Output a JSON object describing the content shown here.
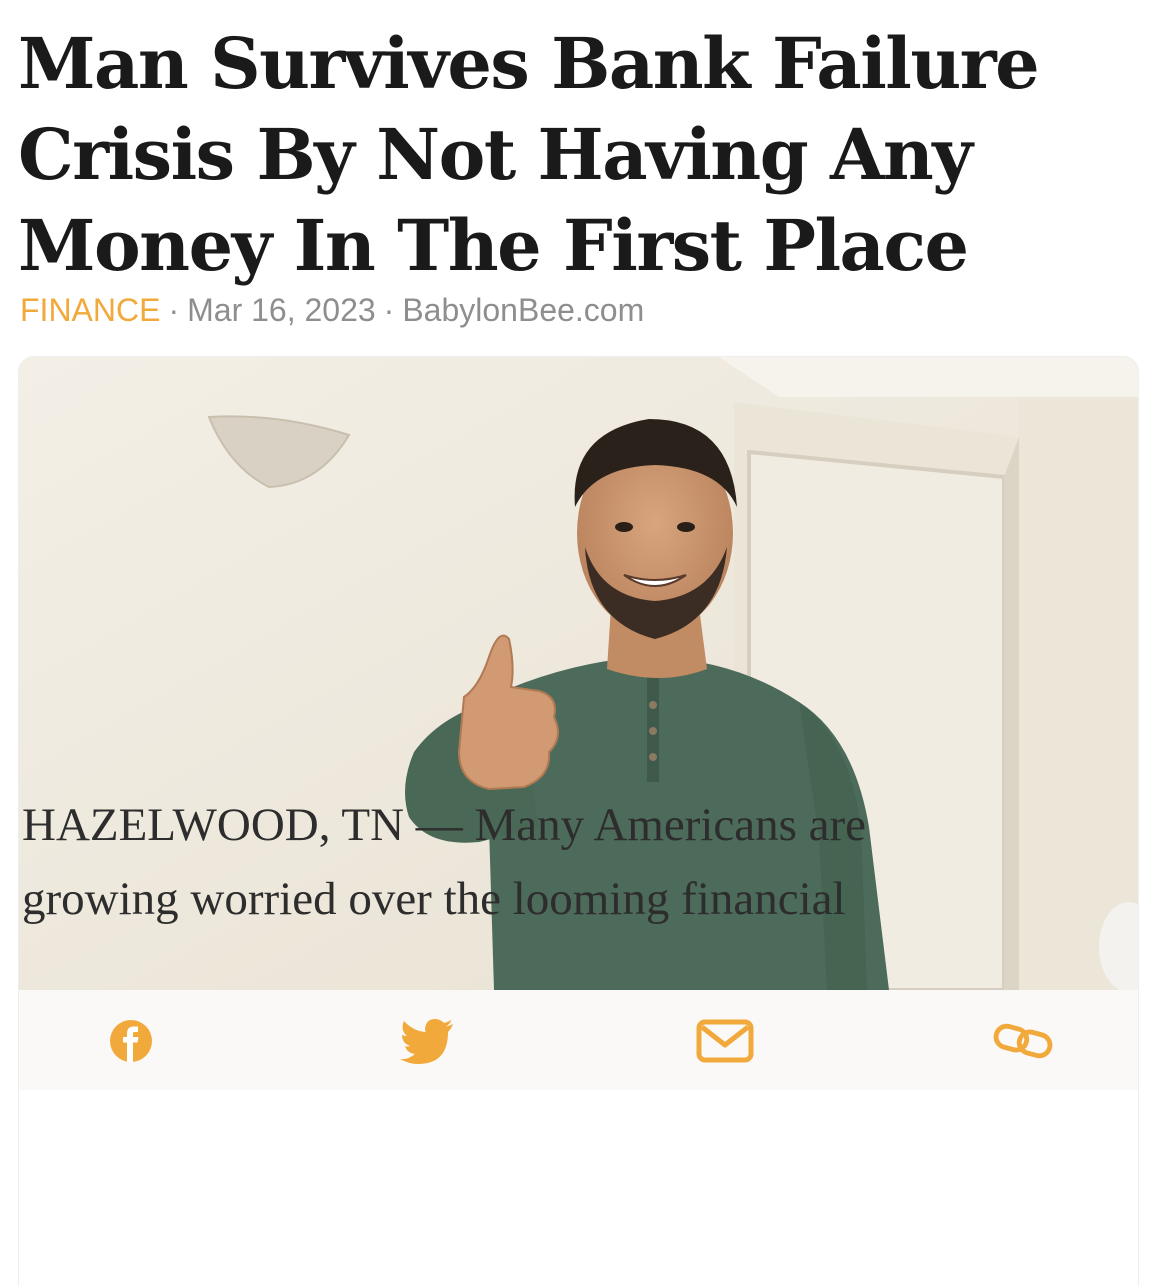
{
  "article": {
    "headline": "Man Survives Bank Failure Crisis By Not Having Any Money In The First Place",
    "category": "FINANCE",
    "separator": "·",
    "date": "Mar 16, 2023",
    "source": "BabylonBee.com",
    "body_line_1": "HAZELWOOD, TN — Many Americans are",
    "body_line_2": "growing worried over the looming financial"
  },
  "share": {
    "icons": [
      "facebook-icon",
      "twitter-icon",
      "email-icon",
      "link-icon"
    ]
  },
  "colors": {
    "accent": "#f2a93b",
    "headline": "#1a1a1a",
    "meta": "#8e8e8e",
    "body": "#2d2d2d"
  }
}
